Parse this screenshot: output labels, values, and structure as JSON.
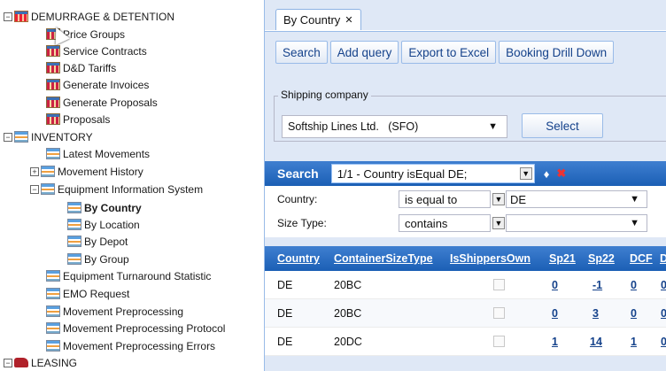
{
  "tree": {
    "items": [
      {
        "label": "DEMURRAGE & DETENTION",
        "toggle": "−",
        "icon": "grid-red"
      },
      {
        "label": "Price Groups",
        "icon": "grid"
      },
      {
        "label": "Service Contracts",
        "icon": "grid"
      },
      {
        "label": "D&D Tariffs",
        "icon": "grid"
      },
      {
        "label": "Generate Invoices",
        "icon": "grid"
      },
      {
        "label": "Generate Proposals",
        "icon": "grid"
      },
      {
        "label": "Proposals",
        "icon": "grid"
      },
      {
        "label": "INVENTORY",
        "toggle": "−",
        "icon": "list"
      },
      {
        "label": "Latest Movements",
        "icon": "list"
      },
      {
        "label": "Movement History",
        "toggle": "+",
        "icon": "list"
      },
      {
        "label": "Equipment Information System",
        "toggle": "−",
        "icon": "list"
      },
      {
        "label": "By Country",
        "icon": "list"
      },
      {
        "label": "By Location",
        "icon": "list"
      },
      {
        "label": "By Depot",
        "icon": "list"
      },
      {
        "label": "By Group",
        "icon": "list"
      },
      {
        "label": "Equipment Turnaround Statistic",
        "icon": "list"
      },
      {
        "label": "EMO Request",
        "icon": "list"
      },
      {
        "label": "Movement Preprocessing",
        "icon": "list"
      },
      {
        "label": "Movement Preprocessing Protocol",
        "icon": "list"
      },
      {
        "label": "Movement Preprocessing Errors",
        "icon": "list"
      },
      {
        "label": "LEASING",
        "toggle": "−",
        "icon": "truck"
      }
    ]
  },
  "tab": {
    "label": "By Country",
    "close": "✕"
  },
  "toolbar": {
    "search": "Search",
    "add_query": "Add query",
    "export": "Export to Excel",
    "drill": "Booking Drill Down"
  },
  "shipping": {
    "legend": "Shipping company",
    "value": "Softship Lines Ltd.   (SFO)",
    "arrow": "▼",
    "select": "Select"
  },
  "search": {
    "title": "Search",
    "query": "1/1 - Country isEqual DE;",
    "arrow": "▼",
    "icon_add": "♦",
    "icon_delete": "✖"
  },
  "filters": {
    "country": {
      "label": "Country:",
      "op": "is equal to",
      "value": "DE",
      "arrow": "▼",
      "opbtn": "▼"
    },
    "size": {
      "label": "Size Type:",
      "op": "contains",
      "value": "",
      "arrow": "▼",
      "opbtn": "▼"
    }
  },
  "grid": {
    "headers": [
      "Country",
      "ContainerSizeType",
      "IsShippersOwn",
      "Sp21",
      "Sp22",
      "DCF",
      "D"
    ],
    "rows": [
      {
        "country": "DE",
        "size": "20BC",
        "sp21": "0",
        "sp22": "-1",
        "dcf": "0",
        "d": "0"
      },
      {
        "country": "DE",
        "size": "20BC",
        "sp21": "0",
        "sp22": "3",
        "dcf": "0",
        "d": "0"
      },
      {
        "country": "DE",
        "size": "20DC",
        "sp21": "1",
        "sp22": "14",
        "dcf": "1",
        "d": "0"
      }
    ]
  }
}
